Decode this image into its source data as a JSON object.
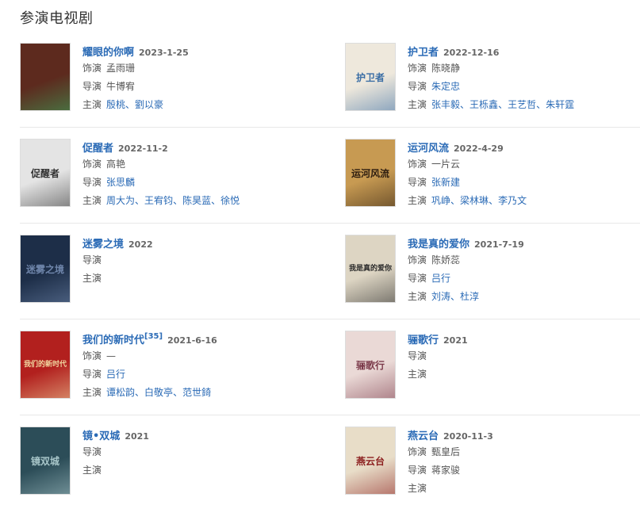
{
  "section_title": "参演电视剧",
  "labels": {
    "role": "饰演",
    "director": "导演",
    "starring": "主演",
    "sep": "、"
  },
  "items": [
    {
      "title": "耀眼的你啊",
      "sup": "",
      "date": "2023-1-25",
      "role": "孟雨珊",
      "director": [
        "牛博宥"
      ],
      "director_link": false,
      "starring": [
        "殷桃",
        "劉以豪"
      ],
      "poster": {
        "bg": "#5d2a1e",
        "accent": "#3aa85c",
        "text": ""
      }
    },
    {
      "title": "护卫者",
      "sup": "",
      "date": "2022-12-16",
      "role": "陈晓静",
      "director": [
        "朱定忠"
      ],
      "director_link": true,
      "starring": [
        "张丰毅",
        "王栎鑫",
        "王艺哲",
        "朱轩霆"
      ],
      "poster": {
        "bg": "#eee8dc",
        "accent": "#3b6ea5",
        "text": "护卫者"
      }
    },
    {
      "title": "促醒者",
      "sup": "",
      "date": "2022-11-2",
      "role": "高艳",
      "director": [
        "张思麟"
      ],
      "director_link": true,
      "starring": [
        "周大为",
        "王宥钧",
        "陈昊蓝",
        "徐悦"
      ],
      "poster": {
        "bg": "#e4e4e4",
        "accent": "#333333",
        "text": "促醒者"
      }
    },
    {
      "title": "运河风流",
      "sup": "",
      "date": "2022-4-29",
      "role": "一片云",
      "director": [
        "张新建"
      ],
      "director_link": true,
      "starring": [
        "巩峥",
        "梁林琳",
        "李乃文"
      ],
      "poster": {
        "bg": "#c79a52",
        "accent": "#2d1d10",
        "text": "运河风流"
      }
    },
    {
      "title": "迷雾之境",
      "sup": "",
      "date": "2022",
      "role": "",
      "director": [],
      "director_link": false,
      "starring": [],
      "poster": {
        "bg": "#1d2e48",
        "accent": "#6f86ab",
        "text": "迷雾之境"
      }
    },
    {
      "title": "我是真的爱你",
      "sup": "",
      "date": "2021-7-19",
      "role": "陈娇蕊",
      "director": [
        "吕行"
      ],
      "director_link": true,
      "starring": [
        "刘涛",
        "杜淳"
      ],
      "poster": {
        "bg": "#ddd5c3",
        "accent": "#2a2a2a",
        "text": "我是真的爱你"
      }
    },
    {
      "title": "我们的新时代",
      "sup": "[35]",
      "date": "2021-6-16",
      "role": "—",
      "director": [
        "吕行"
      ],
      "director_link": true,
      "starring": [
        "谭松韵",
        "白敬亭",
        "范世錡"
      ],
      "poster": {
        "bg": "#b2201e",
        "accent": "#f1d7a0",
        "text": "我们的新时代"
      }
    },
    {
      "title": "骊歌行",
      "sup": "",
      "date": "2021",
      "role": "",
      "director": [],
      "director_link": false,
      "starring": [],
      "poster": {
        "bg": "#ead9d6",
        "accent": "#7c3b4b",
        "text": "骊歌行"
      }
    },
    {
      "title": "镜•双城",
      "sup": "",
      "date": "2021",
      "role": "",
      "director": [],
      "director_link": false,
      "starring": [],
      "poster": {
        "bg": "#2c4d58",
        "accent": "#a8c6c9",
        "text": "镜双城"
      }
    },
    {
      "title": "燕云台",
      "sup": "",
      "date": "2020-11-3",
      "role": "甄皇后",
      "director": [
        "蒋家骏"
      ],
      "director_link": false,
      "starring": [],
      "poster": {
        "bg": "#e8ddc8",
        "accent": "#8b1d1d",
        "text": "燕云台"
      }
    }
  ]
}
